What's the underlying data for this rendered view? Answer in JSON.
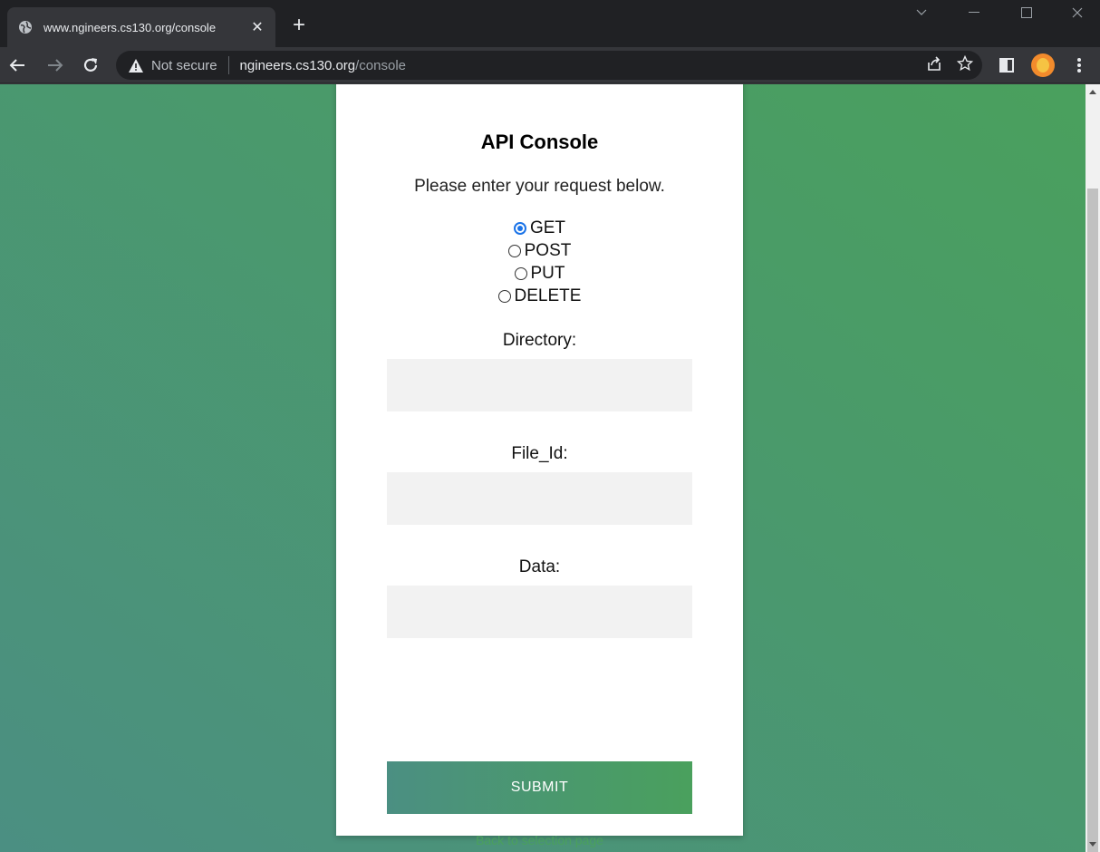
{
  "browser": {
    "tab_title": "www.ngineers.cs130.org/console",
    "tab_close": "✕",
    "new_tab": "+",
    "security_label": "Not secure",
    "url_host": "ngineers.cs130.org",
    "url_path": "/console"
  },
  "card": {
    "title": "API Console",
    "subtitle": "Please enter your request below.",
    "methods": [
      {
        "label": "GET",
        "checked": true
      },
      {
        "label": "POST",
        "checked": false
      },
      {
        "label": "PUT",
        "checked": false
      },
      {
        "label": "DELETE",
        "checked": false
      }
    ],
    "fields": [
      {
        "label": "Directory:",
        "value": ""
      },
      {
        "label": "File_Id:",
        "value": ""
      },
      {
        "label": "Data:",
        "value": ""
      }
    ],
    "submit_label": "SUBMIT",
    "back_link": "Back to selection page"
  },
  "colors": {
    "accent_green": "#4aa05d",
    "accent_teal": "#4b8f82",
    "radio_blue": "#1a73e8"
  },
  "icons": [
    "globe-icon",
    "close-icon",
    "plus-icon",
    "back-arrow-icon",
    "forward-arrow-icon",
    "reload-icon",
    "warning-icon",
    "share-icon",
    "star-icon",
    "side-panel-icon",
    "profile-avatar",
    "kebab-menu-icon",
    "chevron-down-icon",
    "minimize-icon",
    "maximize-icon",
    "window-close-icon"
  ]
}
